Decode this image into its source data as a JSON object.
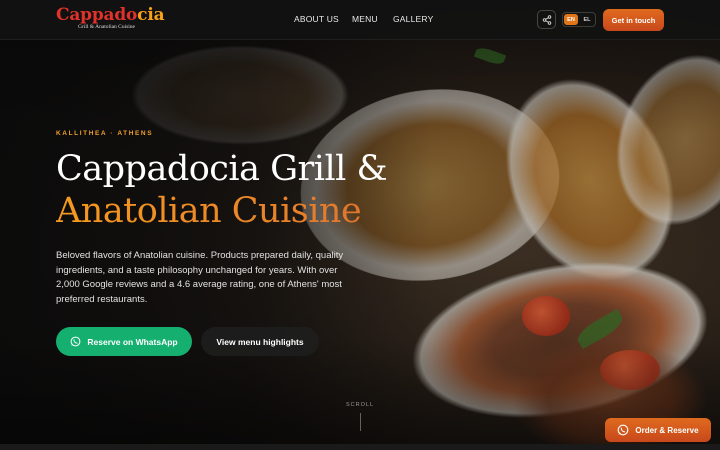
{
  "logo": {
    "name_part1": "Cappado",
    "name_part2": "cia",
    "tagline": "Grill & Anatolian Cuisine"
  },
  "nav": {
    "items": [
      {
        "label": "ABOUT US"
      },
      {
        "label": "MENU"
      },
      {
        "label": "GALLERY"
      }
    ]
  },
  "header": {
    "share_icon": "share-icon",
    "lang_active": "EN",
    "lang_other": "EL",
    "cta_label": "Get in touch"
  },
  "hero": {
    "kicker": "KALLITHEA · ATHENS",
    "title_line1": "Cappadocia Grill &",
    "title_line2": "Anatolian Cuisine",
    "description": "Beloved flavors of Anatolian cuisine. Products prepared daily, quality ingredients, and a taste philosophy unchanged for years. With over 2,000 Google reviews and a 4.6 average rating, one of Athens' most preferred restaurants.",
    "primary_button": "Reserve on WhatsApp",
    "secondary_button": "View menu highlights",
    "scroll_label": "SCROLL"
  },
  "floating": {
    "label": "Order & Reserve",
    "icon": "whatsapp-icon"
  },
  "colors": {
    "accent_orange": "#e06a1e",
    "whatsapp_green": "#15b070",
    "logo_red": "#e0322a",
    "kicker_gold": "#f0a02a"
  }
}
